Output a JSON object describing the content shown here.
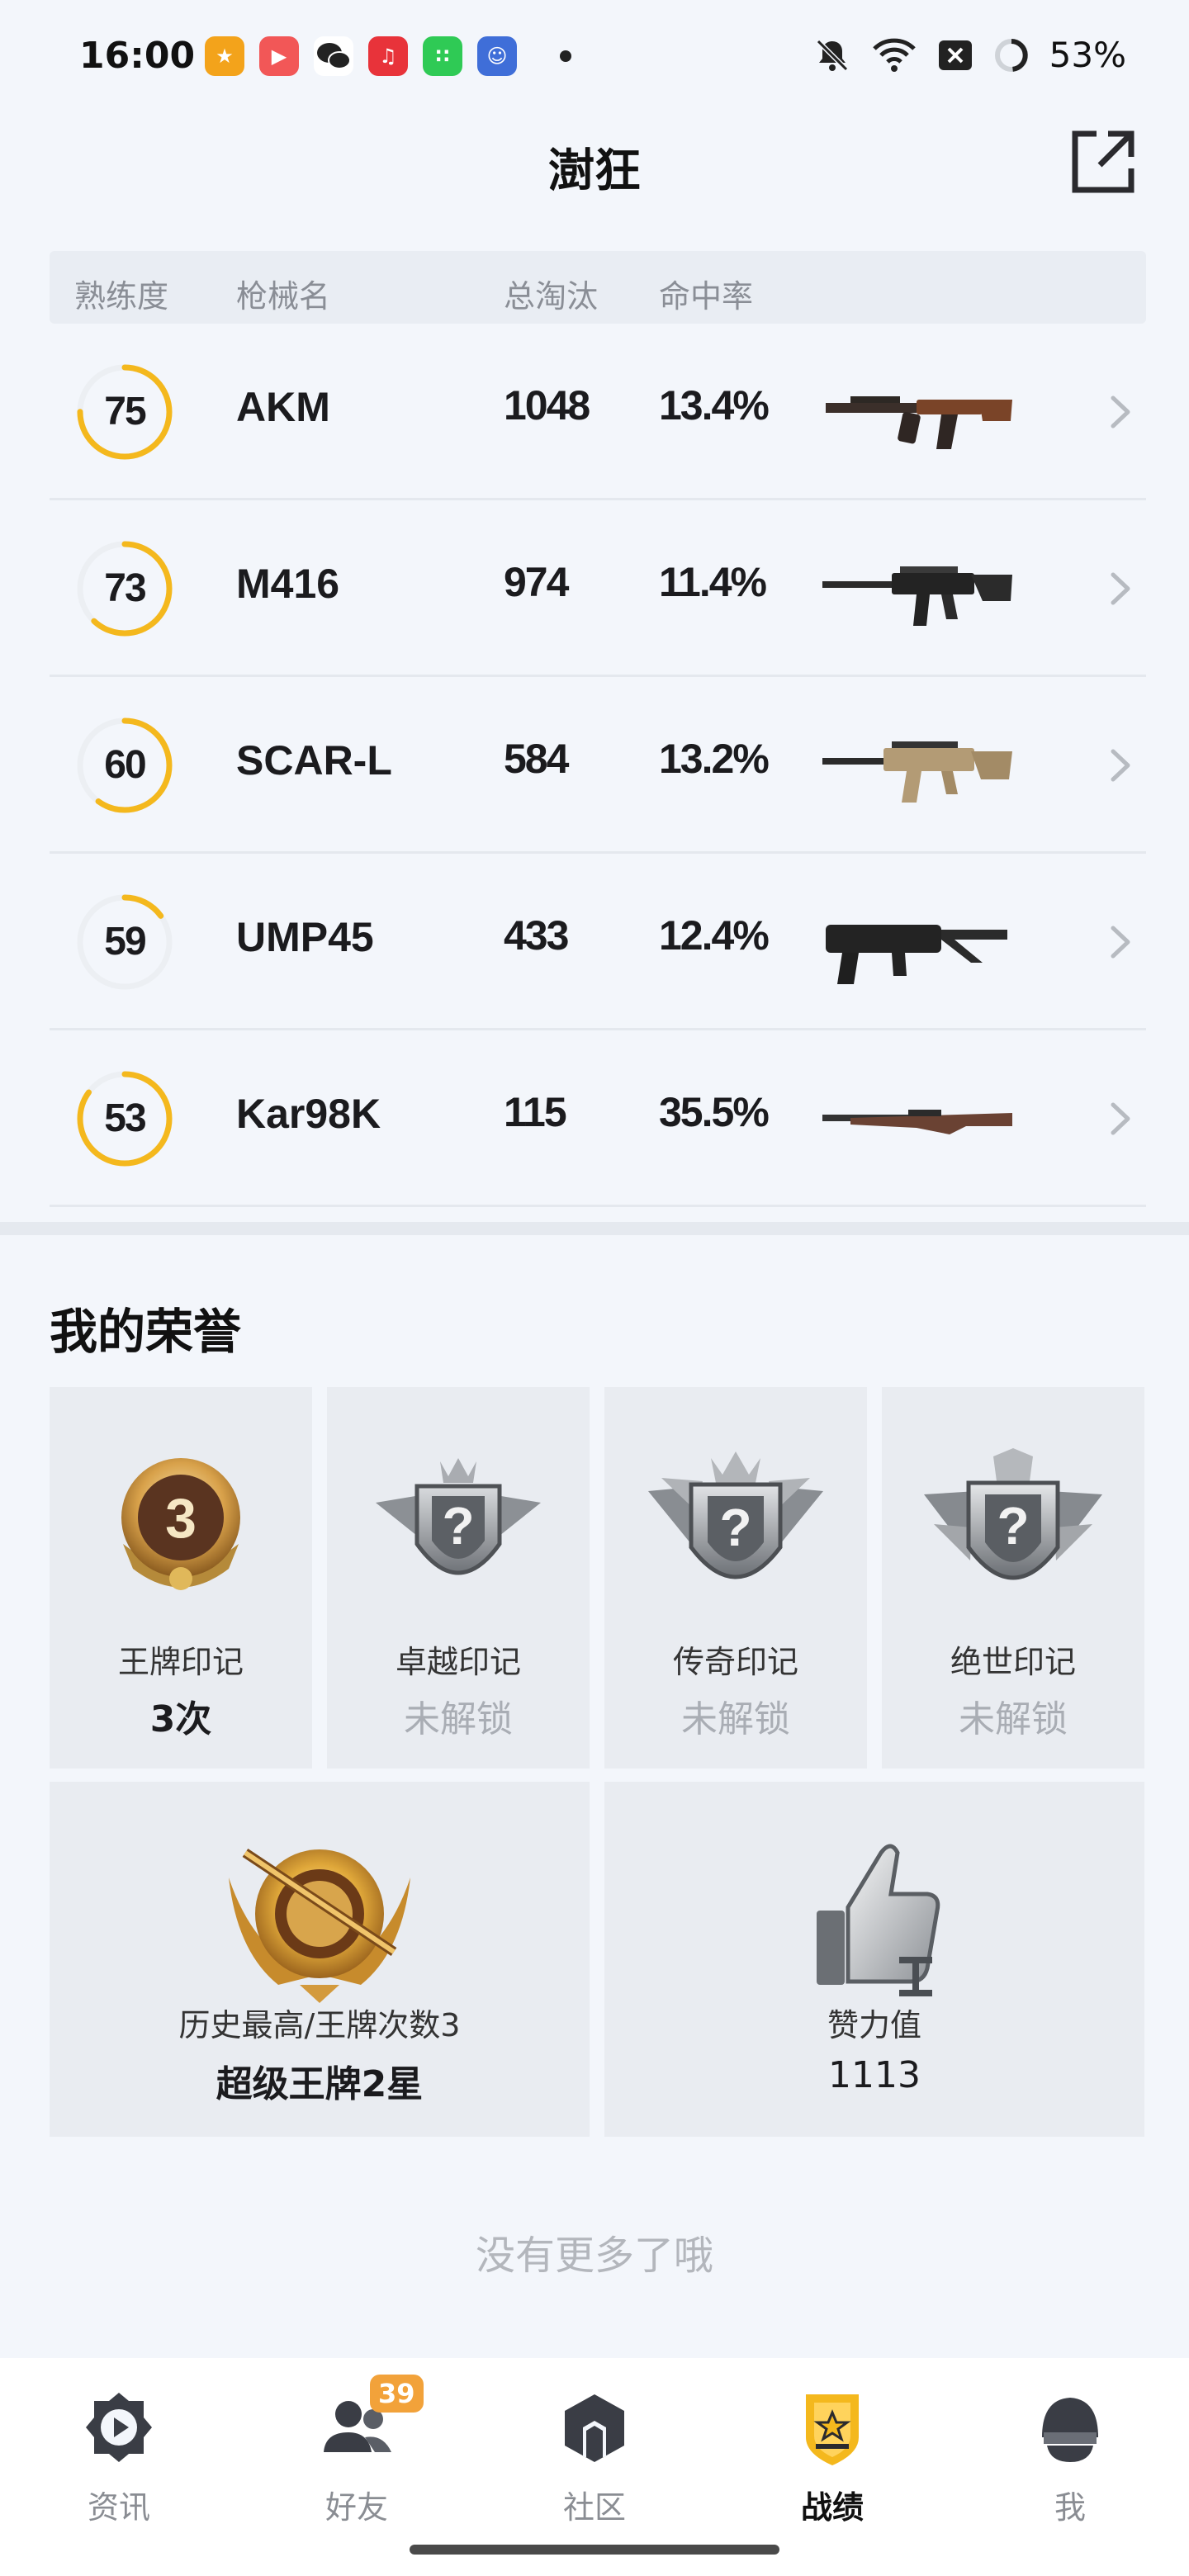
{
  "status_bar": {
    "time": "16:00",
    "battery": "53%",
    "app_icons": [
      {
        "name": "game-app-icon",
        "color": "#f3a31b",
        "glyph": "★"
      },
      {
        "name": "video-app-icon",
        "color": "#f25757",
        "glyph": "▶"
      },
      {
        "name": "wechat-icon",
        "color": "#2b2b2b",
        "glyph": "•"
      },
      {
        "name": "music-app-icon",
        "color": "#e8333a",
        "glyph": "♫"
      },
      {
        "name": "grid-app-icon",
        "color": "#2fca55",
        "glyph": "∷"
      },
      {
        "name": "mascot-app-icon",
        "color": "#3f6ed8",
        "glyph": "☺"
      }
    ]
  },
  "header": {
    "title": "澍狂",
    "share_icon": "share-icon"
  },
  "table": {
    "headers": {
      "proficiency": "熟练度",
      "weapon_name": "枪械名",
      "total_kills": "总淘汰",
      "hit_rate": "命中率"
    },
    "rows": [
      {
        "level": "75",
        "name": "AKM",
        "kills": "1048",
        "rate": "13.4%",
        "progress": 0.75,
        "weapon": "akm"
      },
      {
        "level": "73",
        "name": "M416",
        "kills": "974",
        "rate": "11.4%",
        "progress": 0.62,
        "weapon": "m416"
      },
      {
        "level": "60",
        "name": "SCAR-L",
        "kills": "584",
        "rate": "13.2%",
        "progress": 0.6,
        "weapon": "scar"
      },
      {
        "level": "59",
        "name": "UMP45",
        "kills": "433",
        "rate": "12.4%",
        "progress": 0.15,
        "weapon": "ump"
      },
      {
        "level": "53",
        "name": "Kar98K",
        "kills": "115",
        "rate": "35.5%",
        "progress": 0.85,
        "weapon": "kar"
      }
    ]
  },
  "honors": {
    "title": "我的荣誉",
    "badges": [
      {
        "label": "王牌印记",
        "value": "3次",
        "locked": false,
        "icon": "ace-badge-icon"
      },
      {
        "label": "卓越印记",
        "value": "未解锁",
        "locked": true,
        "icon": "excellence-badge-icon"
      },
      {
        "label": "传奇印记",
        "value": "未解锁",
        "locked": true,
        "icon": "legend-badge-icon"
      },
      {
        "label": "绝世印记",
        "value": "未解锁",
        "locked": true,
        "icon": "peerless-badge-icon"
      }
    ],
    "highest": {
      "label": "历史最高/王牌次数3",
      "value": "超级王牌2星",
      "icon": "super-ace-rank-icon"
    },
    "likes": {
      "label": "赞力值",
      "value": "1113",
      "icon": "thumbs-up-icon"
    }
  },
  "footer_text": "没有更多了哦",
  "nav": {
    "items": [
      {
        "label": "资讯",
        "icon": "news-icon",
        "active": false
      },
      {
        "label": "好友",
        "icon": "friends-icon",
        "active": false,
        "badge": "39"
      },
      {
        "label": "社区",
        "icon": "community-icon",
        "active": false
      },
      {
        "label": "战绩",
        "icon": "stats-icon",
        "active": true
      },
      {
        "label": "我",
        "icon": "profile-icon",
        "active": false
      }
    ]
  },
  "colors": {
    "accent": "#f4b81d",
    "ring_track": "#eceff3",
    "badge_orange": "#f2a23a"
  }
}
